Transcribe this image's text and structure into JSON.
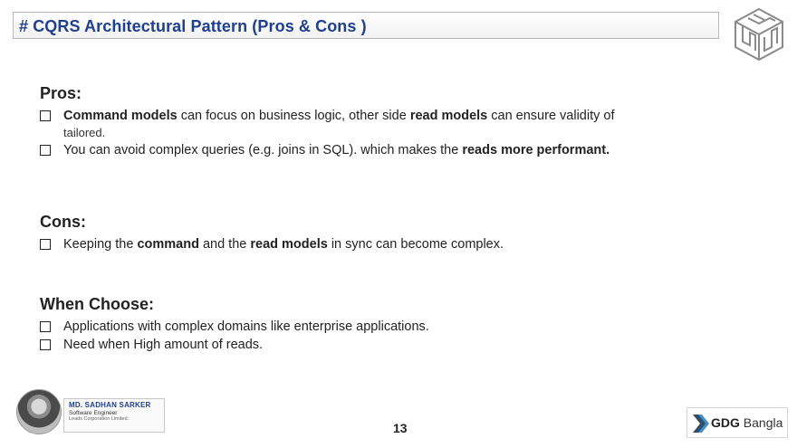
{
  "header": {
    "title": "# CQRS Architectural Pattern (Pros & Cons )"
  },
  "pros": {
    "heading": "Pros:",
    "items": [
      {
        "parts": [
          {
            "b": "Command models"
          },
          {
            "t": " can focus on business logic, other side "
          },
          {
            "b": "read models"
          },
          {
            "t": " can ensure validity of"
          }
        ],
        "sub": "tailored."
      },
      {
        "parts": [
          {
            "t": "You can avoid complex queries (e.g. joins in SQL). which makes the "
          },
          {
            "b": "reads more performant."
          }
        ]
      }
    ]
  },
  "cons": {
    "heading": "Cons:",
    "items": [
      {
        "parts": [
          {
            "t": "Keeping the "
          },
          {
            "b": "command"
          },
          {
            "t": " and the "
          },
          {
            "b": "read models"
          },
          {
            "t": " in sync can become complex."
          }
        ]
      }
    ]
  },
  "when": {
    "heading": "When Choose:",
    "items": [
      {
        "parts": [
          {
            "t": "Applications with complex domains like enterprise applications."
          }
        ]
      },
      {
        "parts": [
          {
            "t": "Need when High amount of reads."
          }
        ]
      }
    ]
  },
  "footer": {
    "author_name": "MD. SADHAN SARKER",
    "author_role": "Software Engineer",
    "author_company": "Leads Corporation Limited.",
    "page_number": "13",
    "brand_gdg": "GDG",
    "brand_region": "Bangla"
  },
  "colors": {
    "title": "#1f3f8f",
    "gdg_chevron_dark": "#2f4f6f",
    "gdg_chevron_light": "#4a8fc4"
  }
}
